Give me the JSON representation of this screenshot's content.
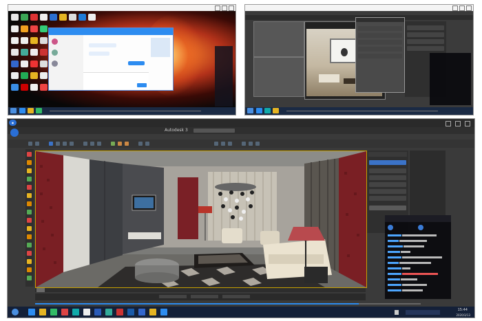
{
  "panel1": {
    "title": "",
    "chat_window": {
      "title": "",
      "contacts": [
        "",
        "",
        ""
      ]
    },
    "taskbar_time": ""
  },
  "panel2": {
    "title": "",
    "taskbar_time": ""
  },
  "panel3": {
    "title": "",
    "app_title": "Autodesk 3",
    "live_chat_lines": [],
    "taskbar_time": "15:44",
    "taskbar_date": "2020/3/13",
    "status_bar_text": ""
  },
  "colors": {
    "accent": "#2d8cf0",
    "wallpaper": "#c8502a",
    "max_bg": "#3b3b3b",
    "taskbar": "#1a2a44"
  }
}
